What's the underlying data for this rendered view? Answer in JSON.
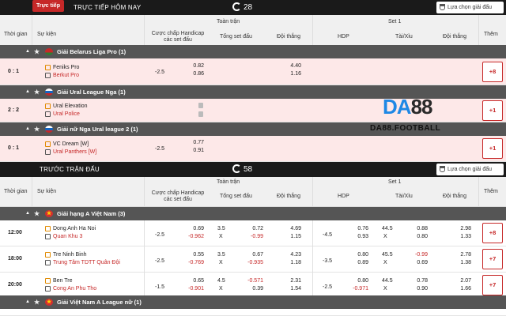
{
  "live_section": {
    "badge": "Trực tiếp",
    "title": "TRỰC TIẾP HÔM NAY",
    "count": "28",
    "picker": "Lựa chọn giải đấu"
  },
  "pre_section": {
    "title": "TRƯỚC TRẬN ĐẤU",
    "count": "58",
    "picker": "Lựa chọn giải đấu"
  },
  "headers": {
    "time": "Thời gian",
    "event": "Sự kiện",
    "fulltime": "Toàn trận",
    "set1": "Set 1",
    "handicap": "Cược chấp Handicap các set đấu",
    "total_sets": "Tổng set đấu",
    "winner": "Đội thắng",
    "hdp": "HDP",
    "over_under": "Tài/Xỉu",
    "more": "Thêm"
  },
  "live_leagues": [
    {
      "name": "Giải Belarus Liga Pro (1)",
      "matches": [
        {
          "time": "0 : 1",
          "home": "Feniks Pro",
          "away": "Berkut Pro",
          "hcp_line": "-2.5",
          "hcp_home": "0.82",
          "hcp_away": "0.86",
          "win_home": "4.40",
          "win_away": "1.16",
          "more": "+8"
        }
      ]
    },
    {
      "name": "Giải Ural League Nga (1)",
      "matches": [
        {
          "time": "2 : 2",
          "home": "Ural Elevation",
          "away": "Ural Police",
          "more": "+1"
        }
      ]
    },
    {
      "name": "Giải nữ Nga Ural league 2 (1)",
      "matches": [
        {
          "time": "0 : 1",
          "home": "VC Dream [W]",
          "away": "Ural Panthers [W]",
          "hcp_line": "-2.5",
          "hcp_home": "0.77",
          "hcp_away": "0.91",
          "more": "+1"
        }
      ]
    }
  ],
  "watermark": {
    "mark_a": "DA",
    "mark_b": "88",
    "site": "DA88.FOOTBALL"
  },
  "pre_leagues": [
    {
      "name": "Giải hạng A Việt Nam (3)",
      "matches": [
        {
          "time": "12:00",
          "home": "Dong Anh Ha Noi",
          "away": "Quan Khu 3",
          "hcp_line": "-2.5",
          "hcp_home": "0.69",
          "hcp_away": "-0.962",
          "tot_line": "3.5",
          "tot_x": "X",
          "tot_home": "0.72",
          "tot_away": "-0.99",
          "win_home": "4.69",
          "win_away": "1.15",
          "hdp_line": "-4.5",
          "hdp_home": "0.76",
          "hdp_away": "0.93",
          "ou_line": "44.5",
          "ou_x": "X",
          "ou_home": "0.88",
          "ou_away": "0.80",
          "s1_win_home": "2.98",
          "s1_win_away": "1.33",
          "more": "+8"
        },
        {
          "time": "18:00",
          "home": "Tre Ninh Binh",
          "away": "Trung Tâm TDTT Quân Đội",
          "hcp_line": "-2.5",
          "hcp_home": "0.55",
          "hcp_away": "-0.769",
          "tot_line": "3.5",
          "tot_x": "X",
          "tot_home": "0.67",
          "tot_away": "-0.935",
          "win_home": "4.23",
          "win_away": "1.18",
          "hdp_line": "-3.5",
          "hdp_home": "0.80",
          "hdp_away": "0.89",
          "ou_line": "45.5",
          "ou_x": "X",
          "ou_home": "-0.99",
          "ou_away": "0.69",
          "s1_win_home": "2.78",
          "s1_win_away": "1.38",
          "more": "+7"
        },
        {
          "time": "20:00",
          "home": "Ben Tre",
          "away": "Cong An Phu Tho",
          "hcp_line": "-1.5",
          "hcp_home": "0.65",
          "hcp_away": "-0.901",
          "tot_line": "4.5",
          "tot_x": "X",
          "tot_home": "-0.571",
          "tot_away": "0.39",
          "win_home": "2.31",
          "win_away": "1.54",
          "hdp_line": "-2.5",
          "hdp_home": "0.80",
          "hdp_away": "-0.971",
          "ou_line": "44.5",
          "ou_x": "X",
          "ou_home": "0.78",
          "ou_away": "0.90",
          "s1_win_home": "2.07",
          "s1_win_away": "1.66",
          "more": "+7"
        }
      ]
    },
    {
      "name": "Giải Việt Nam A League nữ (1)",
      "matches": []
    }
  ],
  "colors": {
    "accent": "#c62828",
    "header_bg": "#1a1a1a",
    "league_bg": "#555555",
    "live_row_bg": "#fde8e8"
  }
}
